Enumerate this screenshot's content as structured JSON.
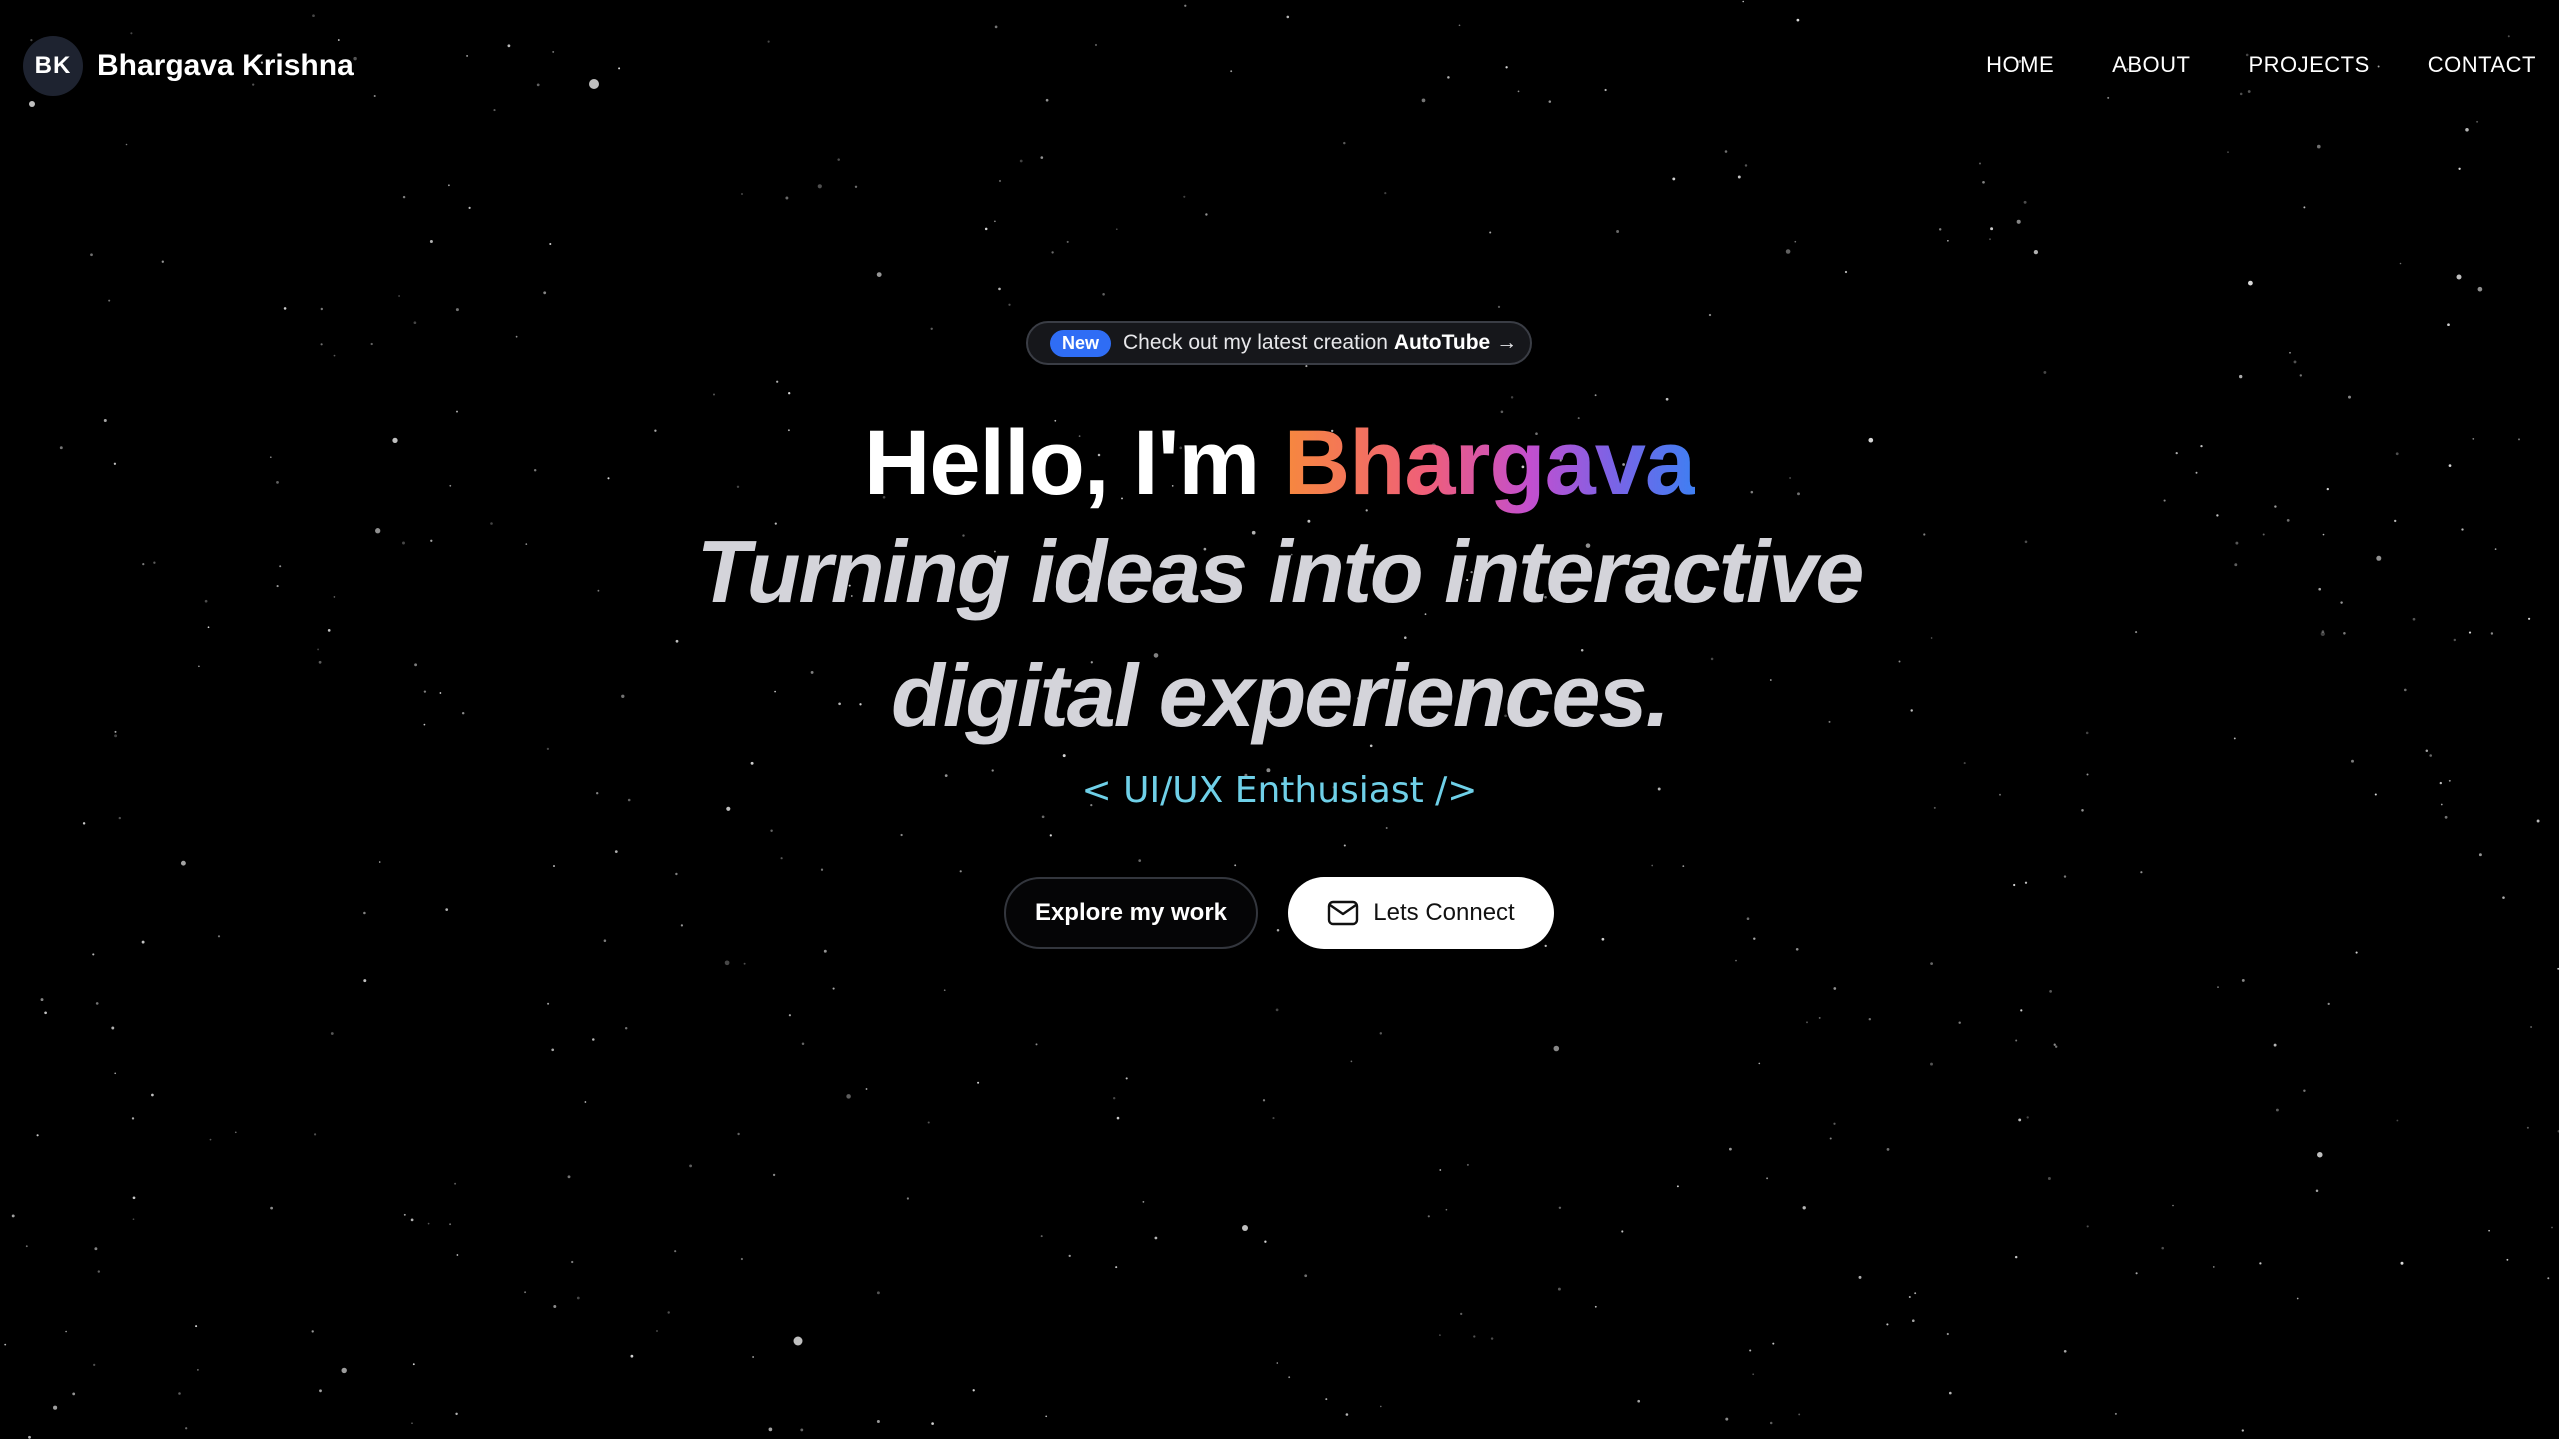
{
  "nav": {
    "avatar_initials": "BK",
    "brand_name": "Bhargava Krishna",
    "links": [
      {
        "label": "HOME"
      },
      {
        "label": "ABOUT"
      },
      {
        "label": "PROJECTS"
      },
      {
        "label": "CONTACT"
      }
    ]
  },
  "announcement": {
    "badge": "New",
    "text": "Check out my latest creation",
    "highlight": "AutoTube",
    "arrow": "→"
  },
  "hero": {
    "greeting": "Hello, I'm ",
    "name": "Bhargava",
    "tagline_line1": "Turning ideas into interactive",
    "tagline_line2": "digital experiences.",
    "role": "< UI/UX Enthusiast />"
  },
  "actions": {
    "explore_label": "Explore my work",
    "connect_label": "Lets Connect",
    "connect_icon": "mail-icon"
  },
  "colors": {
    "background": "#000000",
    "badge_blue": "#2f6df5",
    "role_cyan": "#6fd0e8",
    "gradient": [
      "#f7883e",
      "#ef5e7a",
      "#c24fcf",
      "#7b63e6",
      "#3f7ff2"
    ]
  }
}
